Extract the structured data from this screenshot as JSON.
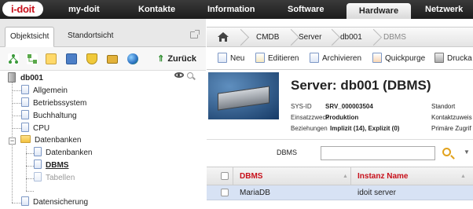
{
  "app": {
    "logo_text": "i-doit"
  },
  "top_menu": {
    "items": [
      {
        "label": "my-doit"
      },
      {
        "label": "Kontakte"
      },
      {
        "label": "Information"
      },
      {
        "label": "Software"
      },
      {
        "label": "Hardware",
        "active": true
      },
      {
        "label": "Netzwerk"
      }
    ]
  },
  "left_panel": {
    "tabs": [
      {
        "label": "Objektsicht",
        "active": true
      },
      {
        "label": "Standortsicht"
      }
    ],
    "toolbar": {
      "icons": [
        "network-icon",
        "tree-icon",
        "calendar-icon",
        "book-icon",
        "shield-icon",
        "lock-icon",
        "globe-icon"
      ],
      "back_label": "Zurück"
    },
    "tree": {
      "root": "db001",
      "items": [
        {
          "label": "Allgemein"
        },
        {
          "label": "Betriebssystem"
        },
        {
          "label": "Buchhaltung"
        },
        {
          "label": "CPU"
        },
        {
          "label": "Datenbanken",
          "type": "folder",
          "expanded": true
        },
        {
          "label": "Datenbanken",
          "level": 2
        },
        {
          "label": "DBMS",
          "level": 2,
          "selected": true
        },
        {
          "label": "Tabellen",
          "level": 2,
          "muted": true
        },
        {
          "label": "Datensicherung"
        }
      ]
    }
  },
  "breadcrumb": {
    "items": [
      "CMDB",
      "Server",
      "db001",
      "DBMS"
    ]
  },
  "actions": [
    {
      "label": "Neu"
    },
    {
      "label": "Editieren"
    },
    {
      "label": "Archivieren"
    },
    {
      "label": "Quickpurge"
    },
    {
      "label": "Drucka"
    }
  ],
  "object_header": {
    "title": "Server: db001 (DBMS)",
    "fields": [
      {
        "key": "SYS-ID",
        "value": "SRV_000003504"
      },
      {
        "key": "Einsatzzweck",
        "value": "Produktion"
      },
      {
        "key": "Beziehungen",
        "value": "Implizit (14), Explizit (0)"
      }
    ],
    "right_keys": [
      "Standort",
      "Kontaktzuweis",
      "Primäre Zugrif"
    ]
  },
  "filter": {
    "label": "DBMS",
    "value": ""
  },
  "table": {
    "columns": [
      "DBMS",
      "Instanz Name"
    ],
    "rows": [
      [
        "MariaDB",
        "idoit server"
      ]
    ]
  },
  "colors": {
    "accent_red": "#c8101b",
    "topbar": "#1c1c1c",
    "selected_row": "#d7e2f4"
  }
}
